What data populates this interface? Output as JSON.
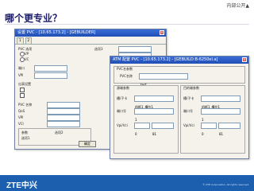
{
  "header": {
    "tag": "内部公开▲",
    "title": "哪个更专业？"
  },
  "win1": {
    "title": "设置 PVC - [10.65.173.2] - [GEBUILDER]",
    "labels": [
      "PVC 选项",
      "VP",
      "VC",
      "端口",
      "VPI",
      "出表设置",
      "PVC 名称",
      "QoS",
      "VPI",
      "VCI",
      "通道类型",
      "参数",
      "选项1",
      "选项2",
      "选项3",
      "自动生成",
      "生成关系"
    ],
    "btn": "确定"
  },
  "win2": {
    "title": "ATM 配置 PVC - [10.65.173.2] - [GEBUILD:B-6250el.a]",
    "group": "PVC名参数",
    "name_label": "PVC名称",
    "name_value": "test",
    "left_group": "源端参数",
    "right_group": "目的端参数",
    "rows": [
      {
        "label": "槽/子卡",
        "value": "机框1_槽位1"
      },
      {
        "label": "端口号",
        "value": "1"
      },
      {
        "label": "Vpi/Vci",
        "vpi": "0",
        "vci": "81"
      }
    ],
    "rows_r": [
      {
        "label": "槽/子卡",
        "value": "机框1_槽位1"
      },
      {
        "label": "端口号",
        "value": "1"
      },
      {
        "label": "Vpi/Vci",
        "vpi": "0",
        "vci": "81"
      }
    ]
  },
  "footer": {
    "logo": "ZTE中兴",
    "copyright": "© ZTE Corporation. All rights reserved."
  }
}
